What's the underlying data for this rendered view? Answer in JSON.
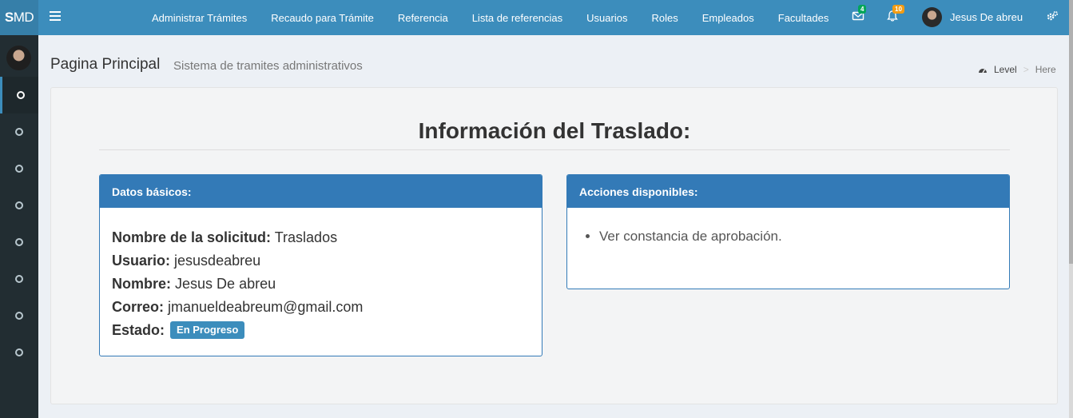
{
  "brand": {
    "bold": "S",
    "rest": "MD"
  },
  "nav": [
    "Administrar Trámites",
    "Recaudo para Trámite",
    "Referencia",
    "Lista de referencias",
    "Usuarios",
    "Roles",
    "Empleados",
    "Facultades"
  ],
  "notifications": {
    "messages_count": "4",
    "alerts_count": "10",
    "messages_color": "#00a65a",
    "alerts_color": "#f39c12"
  },
  "user": {
    "name": "Jesus De abreu"
  },
  "page": {
    "title": "Pagina Principal",
    "subtitle": "Sistema de tramites administrativos"
  },
  "breadcrumb": {
    "level": "Level",
    "sep": ">",
    "here": "Here"
  },
  "main": {
    "heading": "Información del Traslado:",
    "basic": {
      "header": "Datos básicos:",
      "rows": [
        {
          "label": "Nombre de la solicitud:",
          "value": "Traslados"
        },
        {
          "label": "Usuario:",
          "value": "jesusdeabreu"
        },
        {
          "label": "Nombre:",
          "value": "Jesus De abreu"
        },
        {
          "label": "Correo:",
          "value": "jmanueldeabreum@gmail.com"
        }
      ],
      "status_label": "Estado:",
      "status_value": "En Progreso"
    },
    "actions": {
      "header": "Acciones disponibles:",
      "items": [
        "Ver constancia de aprobación."
      ]
    }
  },
  "colors": {
    "header": "#3c8dbc",
    "sidebar": "#222d32",
    "panel": "#337ab7"
  }
}
